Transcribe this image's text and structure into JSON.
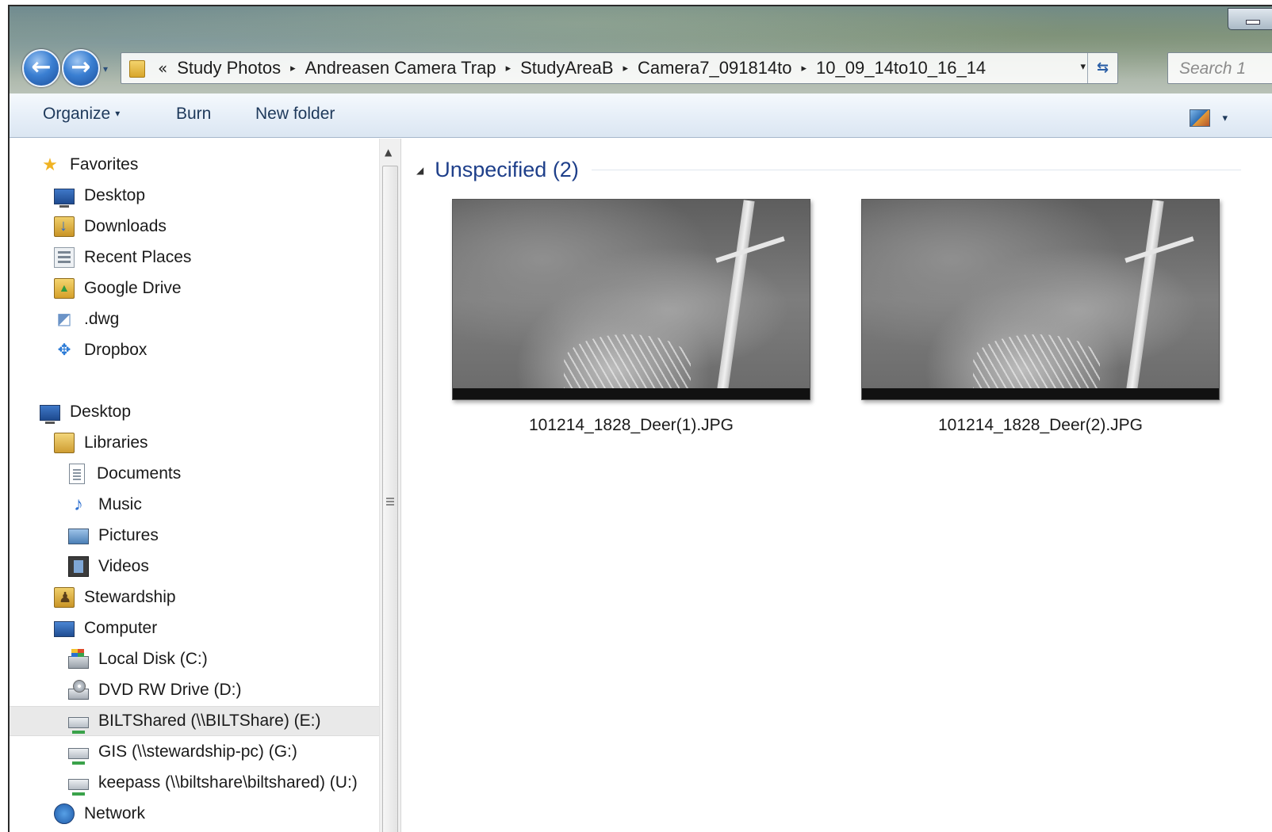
{
  "window": {
    "nav": {
      "back_glyph": "←",
      "forward_glyph": "→",
      "recent_glyph": "▾"
    },
    "address": {
      "overflow": "«",
      "breadcrumbs": [
        "Study Photos",
        "Andreasen Camera Trap",
        "StudyAreaB",
        "Camera7_091814to",
        "10_09_14to10_16_14"
      ],
      "separator": "▸",
      "dropdown_glyph": "▾",
      "refresh_glyph": "⇆"
    },
    "search": {
      "placeholder": "Search 1"
    }
  },
  "toolbar": {
    "organize_label": "Organize",
    "caret": "▾",
    "burn_label": "Burn",
    "new_folder_label": "New folder",
    "view_caret": "▾"
  },
  "sidebar": {
    "favorites_header": "Favorites",
    "favorites": [
      {
        "label": "Desktop",
        "icon": "desktop-icon"
      },
      {
        "label": "Downloads",
        "icon": "downloads-icon"
      },
      {
        "label": "Recent Places",
        "icon": "recent-places-icon"
      },
      {
        "label": "Google Drive",
        "icon": "google-drive-icon"
      },
      {
        "label": ".dwg",
        "icon": "dwg-icon"
      },
      {
        "label": "Dropbox",
        "icon": "dropbox-icon"
      }
    ],
    "desktop_header": "Desktop",
    "libraries": "Libraries",
    "library_items": [
      "Documents",
      "Music",
      "Pictures",
      "Videos"
    ],
    "stewardship": "Stewardship",
    "computer": "Computer",
    "drives": [
      {
        "label": "Local Disk (C:)",
        "icon": "local-disk-icon"
      },
      {
        "label": "DVD RW Drive (D:)",
        "icon": "dvd-drive-icon"
      },
      {
        "label": "BILTShared (\\\\BILTShare) (E:)",
        "icon": "network-drive-icon",
        "selected": true
      },
      {
        "label": "GIS (\\\\stewardship-pc) (G:)",
        "icon": "network-drive-icon"
      },
      {
        "label": "keepass (\\\\biltshare\\biltshared) (U:)",
        "icon": "network-drive-icon"
      }
    ],
    "network": "Network"
  },
  "content": {
    "group_caret": "◢",
    "group_title": "Unspecified (2)",
    "files": [
      {
        "name": "101214_1828_Deer(1).JPG"
      },
      {
        "name": "101214_1828_Deer(2).JPG"
      }
    ]
  }
}
